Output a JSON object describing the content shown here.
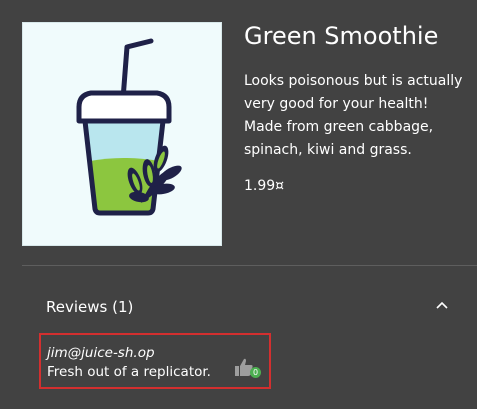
{
  "product": {
    "name": "Green Smoothie",
    "description": "Looks poisonous but is actually very good for your health! Made from green cabbage, spinach, kiwi and grass.",
    "price": "1.99¤"
  },
  "reviews": {
    "title": "Reviews (1)",
    "items": [
      {
        "author": "jim@juice-sh.op",
        "text": "Fresh out of a replicator.",
        "likes": "0"
      }
    ]
  }
}
